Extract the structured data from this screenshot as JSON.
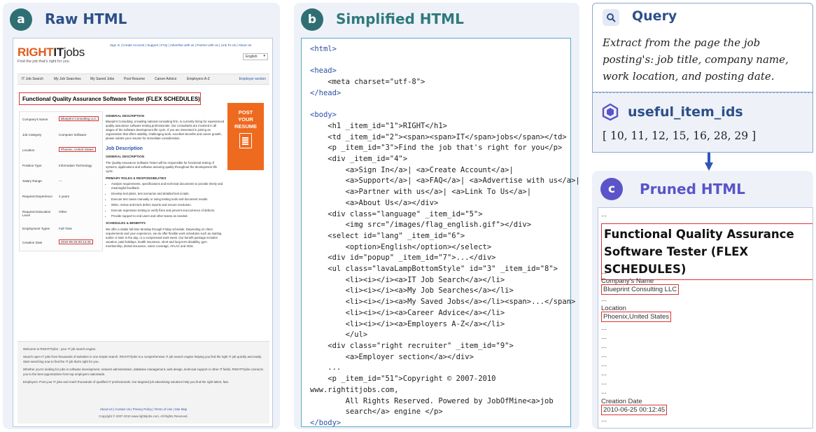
{
  "panel_a": {
    "badge": "a",
    "title": "Raw HTML",
    "site": {
      "logo_right": "RIGHT",
      "logo_it": "IT",
      "logo_jobs": "jobs",
      "tagline": "Find the job that's right for you",
      "top_links": "Sign In  |  Create Account  |  Support  |  FAQ  |  Advertise with us  |  Partner with us  |  Link To Us  |  About Us",
      "language": "English",
      "nav": [
        "IT Job Search",
        "My Job Searches",
        "My Saved Jobs",
        "Post Resume",
        "Career Advice",
        "Employers A-Z"
      ],
      "employer_section": "Employer section",
      "job_title": "Functional Quality Assurance Software Tester (FLEX SCHEDULES)",
      "details": [
        {
          "label": "Company's Name",
          "value": "Blueprint Consulting LLC"
        },
        {
          "label": "Job Category",
          "value": "Computer Software"
        },
        {
          "label": "Location",
          "value": "Phoenix, United States"
        },
        {
          "label": "Position Type",
          "value": "Information Technology"
        },
        {
          "label": "Salary Range",
          "value": "---"
        },
        {
          "label": "Required Experience",
          "value": "4 years"
        },
        {
          "label": "Required Education Level",
          "value": "Other"
        },
        {
          "label": "Employment Types",
          "value": "Full-Time"
        },
        {
          "label": "Creation Date",
          "value": "2010-06-25 00:12:45"
        }
      ],
      "general_description_heading": "GENERAL DESCRIPTION",
      "general_description": "Blueprint Consulting, a leading national consulting firm, is currently hiring for experienced quality assurance software testing professionals. Our consultants are involved in all stages of the software development life cycle. If you are interested in joining an organization that offers stability, challenging work, excellent benefits and career growth, please submit your resume for immediate consideration.",
      "job_description_heading": "Job Description",
      "general_description_heading_2": "GENERAL DESCRIPTION",
      "job_description": "The Quality Assurance Software Tester will be responsible for functional testing of systems, applications and software assuring quality throughout the development life cycle.",
      "roles_heading": "PRIMARY ROLES & RESPONSIBILITIES",
      "roles": [
        "Analyze requirements, specifications and technical documents to provide timely and meaningful feedback.",
        "Develop test plans, test scenarios and detailed test scripts.",
        "Execute test cases manually or using testing tools and document results.",
        "Write, review and track defect reports and ensure resolution.",
        "Execute regression testing to verify fixes and prevent reoccurrence of defects.",
        "Provide support to end users and other teams as needed."
      ],
      "schedules_heading": "SCHEDULES & BENEFITS",
      "schedules": "We offer a stable full-time Monday through Friday schedule. Depending on client requirements and your experience, we do offer flexible work schedules such as starting earlier or later in the day, or a compressed work week. Our benefit package includes vacation, paid holidays, health insurance, short and long term disability, gym membership, dental insurance, vision coverage, AFLAC and 401k.",
      "post_resume": [
        "POST",
        "YOUR",
        "RESUME"
      ],
      "footer_paragraphs": [
        "Welcome to RIGHTITjobs - your IT job search engine.",
        "Search open IT jobs from thousands of websites in one simple search. RIGHTITjobs is a comprehensive IT job search engine helping you find the right IT job quickly and easily. Start searching now to find the IT job that's right for you.",
        "Whether you're looking for jobs in software development, network administration, database management, web design, technical support or other IT fields, RIGHTITjobs connects you to the best opportunities from top employers nationwide.",
        "Employers: Post your IT jobs and reach thousands of qualified IT professionals. Our targeted job advertising solutions help you find the right talent, fast."
      ],
      "footer_links": "About Us  |  Contact Us  |  Privacy Policy  |  Terms of Use  |  Site Map",
      "copyright": "Copyright © 2007-2010 www.rightitjobs.com, All Rights Reserved."
    }
  },
  "panel_b": {
    "badge": "b",
    "title": "Simplified HTML",
    "code_lines": [
      "<html>",
      "",
      "<head>",
      "    <meta charset=\"utf-8\">",
      "</head>",
      "",
      "<body>",
      "    <h1 _item_id=\"1\">RIGHT</h1>",
      "    <td _item_id=\"2\"><span><span>IT</span>jobs</span></td>",
      "    <p _item_id=\"3\">Find the job that's right for you</p>",
      "    <div _item_id=\"4\">",
      "        <a>Sign In</a>| <a>Create Account</a>|",
      "        <a>Support</a>| <a>FAQ</a>| <a>Advertise with us</a>|",
      "        <a>Partner with us</a>| <a>Link To Us</a>|",
      "        <a>About Us</a></div>",
      "    <div class=\"language\" _item_id=\"5\">",
      "        <img src=\"/images/flag_english.gif\"></div>",
      "    <select id=\"lang\" _item_id=\"6\">",
      "        <option>English</option></select>",
      "    <div id=\"popup\" _item_id=\"7\">...</div>",
      "    <ul class=\"lavaLampBottomStyle\" id=\"3\" _item_id=\"8\">",
      "        <li><i></i><a>IT Job Search</a></li>",
      "        <li><i></i><a>My Job Searches</a></li>",
      "        <li><i></i><a>My Saved Jobs</a></li><span>...</span>",
      "        <li><i></i><a>Career Advice</a></li>",
      "        <li><i></i><a>Employers A-Z</a></li>",
      "        </ul>",
      "    <div class=\"right recruiter\" _item_id=\"9\">",
      "        <a>Employer section</a></div>",
      "    ...",
      "    <p _item_id=\"51\">Copyright © 2007-2010",
      "www.rightitjobs.com,",
      "        All Rights Reserved. Powered by JobOfMine<a>job",
      "        search</a> engine </p>",
      "</body>",
      "",
      "</html>"
    ]
  },
  "query": {
    "heading": "Query",
    "text": "Extract from the page the job posting's: job title, company name, work location, and posting date."
  },
  "useful_ids": {
    "heading": "useful_item_ids",
    "values": "[ 10, 11, 12, 15, 16, 28, 29 ]"
  },
  "panel_c": {
    "badge": "c",
    "title": "Pruned HTML",
    "job_title": "Functional Quality Assurance Software Tester (FLEX SCHEDULES)",
    "company_label": "Company's Name",
    "company_value": "Blueprint Consulting LLC",
    "location_label": "Location",
    "location_value": "Phoenix,United States",
    "date_label": "Creation Date",
    "date_value": "2010-06-25 00:12:45",
    "ellipsis": "..."
  },
  "colors": {
    "accent": "#2d4f8a",
    "badge": "#2f6f73",
    "highlight": "#dd3333",
    "panel_bg": "#eef2f8",
    "orange": "#ee6a1e"
  }
}
